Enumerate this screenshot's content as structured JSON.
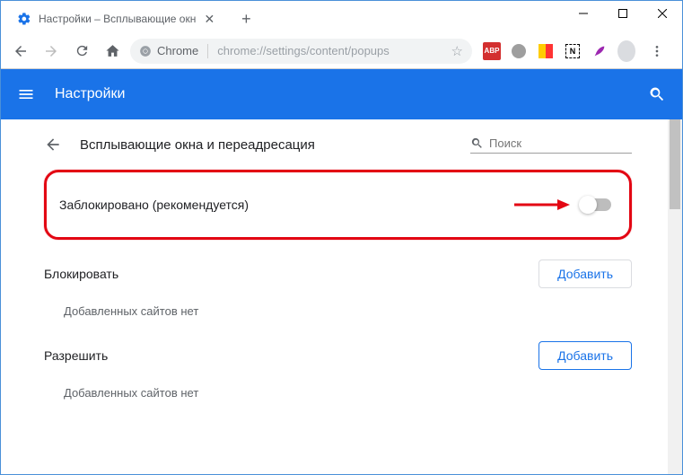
{
  "tab": {
    "title": "Настройки – Всплывающие окн"
  },
  "address": {
    "host": "Chrome",
    "path": "chrome://settings/content/popups"
  },
  "appbar": {
    "title": "Настройки"
  },
  "page": {
    "title": "Всплывающие окна и переадресация",
    "search_placeholder": "Поиск"
  },
  "toggle": {
    "label": "Заблокировано (рекомендуется)"
  },
  "block_section": {
    "title": "Блокировать",
    "add": "Добавить",
    "empty": "Добавленных сайтов нет"
  },
  "allow_section": {
    "title": "Разрешить",
    "add": "Добавить",
    "empty": "Добавленных сайтов нет"
  },
  "extensions": {
    "abp": "ABP"
  }
}
